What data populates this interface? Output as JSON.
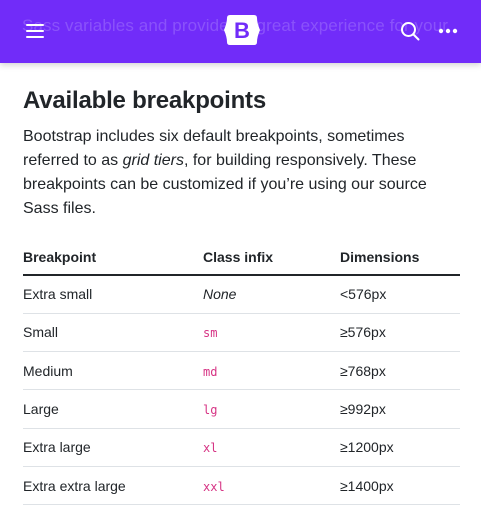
{
  "navbar": {
    "background_color": "#712cf9",
    "ghost_text": "Sass variables and provides a great experience for your",
    "menu_icon": "hamburger-menu-icon",
    "brand_letter": "B",
    "search_icon": "search-icon",
    "more_icon": "more-dots-icon"
  },
  "section": {
    "title": "Available breakpoints",
    "intro_part1": "Bootstrap includes six default breakpoints, sometimes referred to as ",
    "intro_em": "grid tiers",
    "intro_part2": ", for building responsively. These breakpoints can be customized if you’re using our source Sass files."
  },
  "table": {
    "headers": [
      "Breakpoint",
      "Class infix",
      "Dimensions"
    ],
    "rows": [
      {
        "breakpoint": "Extra small",
        "infix": "None",
        "dimensions": "<576px"
      },
      {
        "breakpoint": "Small",
        "infix": "sm",
        "dimensions": "≥576px"
      },
      {
        "breakpoint": "Medium",
        "infix": "md",
        "dimensions": "≥768px"
      },
      {
        "breakpoint": "Large",
        "infix": "lg",
        "dimensions": "≥992px"
      },
      {
        "breakpoint": "Extra large",
        "infix": "xl",
        "dimensions": "≥1200px"
      },
      {
        "breakpoint": "Extra extra large",
        "infix": "xxl",
        "dimensions": "≥1400px"
      }
    ]
  },
  "colors": {
    "accent": "#712cf9",
    "code": "#d63384",
    "text": "#212529"
  }
}
